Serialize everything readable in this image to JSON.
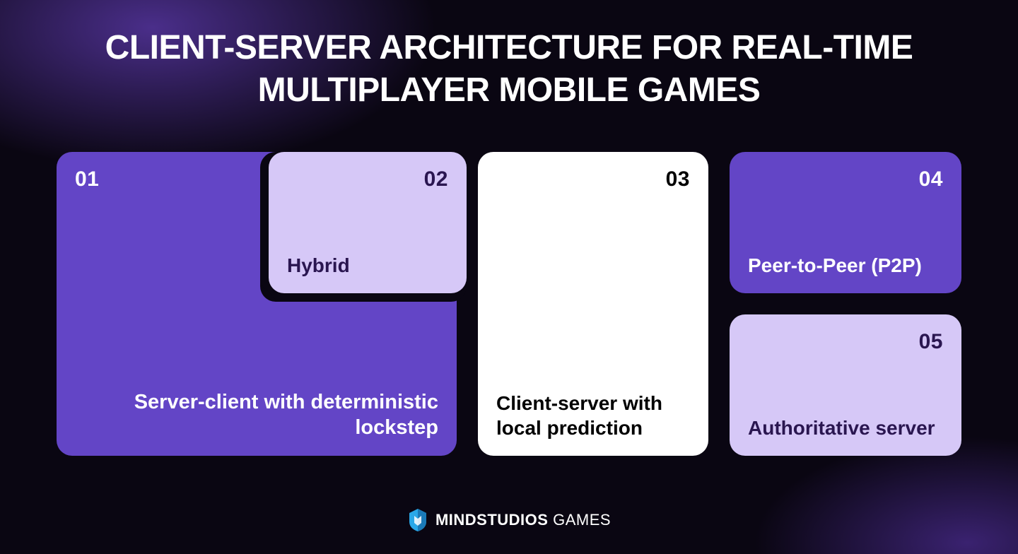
{
  "title": "CLIENT-SERVER ARCHITECTURE FOR REAL-TIME MULTIPLAYER MOBILE GAMES",
  "cards": {
    "c01": {
      "num": "01",
      "label": "Server-client with deterministic lockstep"
    },
    "c02": {
      "num": "02",
      "label": "Hybrid"
    },
    "c03": {
      "num": "03",
      "label": "Client-server with local prediction"
    },
    "c04": {
      "num": "04",
      "label": "Peer-to-Peer (P2P)"
    },
    "c05": {
      "num": "05",
      "label": "Authoritative server"
    }
  },
  "brand": {
    "name": "MINDSTUDIOS",
    "suffix": "GAMES"
  },
  "colors": {
    "purple": "#6345c6",
    "lavender": "#d6c8f7",
    "white": "#ffffff",
    "bg": "#0a0612"
  }
}
